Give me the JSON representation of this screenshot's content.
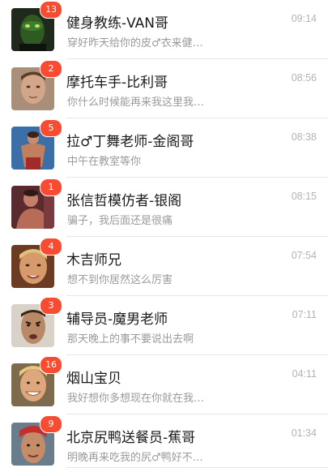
{
  "chats": [
    {
      "name": "健身教练-VAN哥",
      "preview": "穿好昨天给你的皮♂衣来健…",
      "time": "09:14",
      "unread": "13",
      "avatar": "avatar-green-mask"
    },
    {
      "name": "摩托车手-比利哥",
      "preview": "你什么时候能再来我这里我…",
      "time": "08:56",
      "unread": "2",
      "avatar": "avatar-man-portrait"
    },
    {
      "name": "拉♂丁舞老师-金阁哥",
      "preview": "中午在教室等你",
      "time": "08:38",
      "unread": "5",
      "avatar": "avatar-dancer"
    },
    {
      "name": "张信哲模仿者-银阁",
      "preview": "骗子，我后面还是很痛",
      "time": "08:15",
      "unread": "1",
      "avatar": "avatar-shirtless-man"
    },
    {
      "name": "木吉师兄",
      "preview": "想不到你居然这么厉害",
      "time": "07:54",
      "unread": "4",
      "avatar": "avatar-blond-man"
    },
    {
      "name": "辅导员-魔男老师",
      "preview": "那天晚上的事不要说出去啊",
      "time": "07:11",
      "unread": "3",
      "avatar": "avatar-intense-man"
    },
    {
      "name": "烟山宝贝",
      "preview": "我好想你多想现在你就在我…",
      "time": "04:11",
      "unread": "16",
      "avatar": "avatar-smiling-man"
    },
    {
      "name": "北京尻鸭送餐员-蕉哥",
      "preview": "明晚再来吃我的尻♂鸭好不…",
      "time": "01:34",
      "unread": "9",
      "avatar": "avatar-bandana-man"
    }
  ]
}
